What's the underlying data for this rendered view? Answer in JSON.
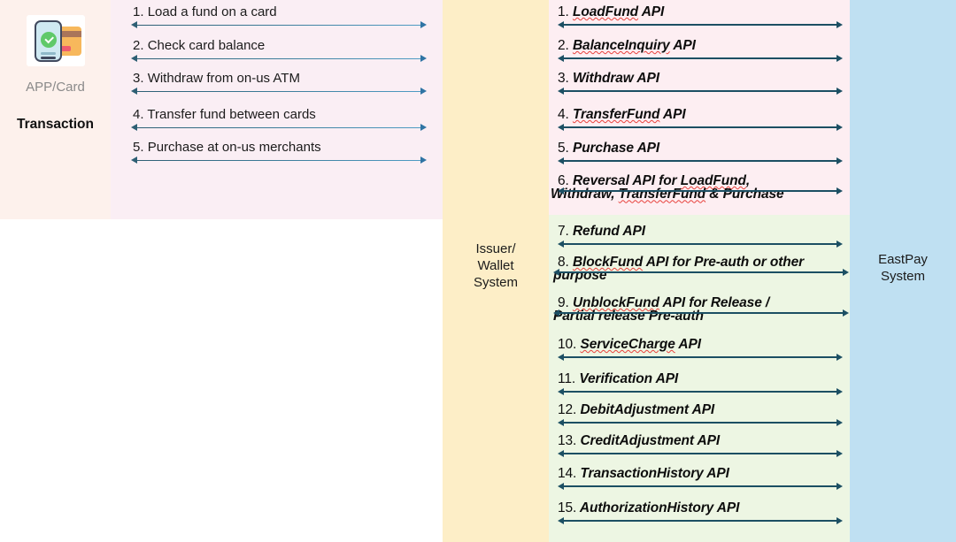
{
  "diagram": {
    "actors": {
      "left": {
        "icon_name": "phone-with-card-icon",
        "label": "APP/Card",
        "sublabel": "Transaction"
      },
      "middle": {
        "label": "Issuer/\nWallet\nSystem",
        "line1": "Issuer/",
        "line2": "Wallet",
        "line3": "System"
      },
      "right": {
        "label": "EastPay\nSystem",
        "line1": "EastPay",
        "line2": "System"
      }
    },
    "transaction_flows": [
      {
        "num": "1.",
        "text": "Load a fund on a card"
      },
      {
        "num": "2.",
        "text": "Check card balance"
      },
      {
        "num": "3.",
        "text": "Withdraw from on-us ATM"
      },
      {
        "num": "4.",
        "text": "Transfer fund between cards"
      },
      {
        "num": "5.",
        "text": "Purchase at on-us merchants"
      }
    ],
    "api_flows_core": [
      {
        "num": "1.",
        "text": "LoadFund API",
        "misspelled": [
          "LoadFund"
        ]
      },
      {
        "num": "2.",
        "text": "BalanceInquiry API",
        "misspelled": [
          "BalanceInquiry"
        ]
      },
      {
        "num": "3.",
        "text": "Withdraw API",
        "misspelled": []
      },
      {
        "num": "4.",
        "text": "TransferFund API",
        "misspelled": [
          "TransferFund"
        ]
      },
      {
        "num": "5.",
        "text": "Purchase API",
        "misspelled": []
      },
      {
        "num": "6.",
        "text": "Reversal API for LoadFund, Withdraw, TransferFund & Purchase",
        "misspelled": [
          "LoadFund",
          "TransferFund"
        ]
      }
    ],
    "api_flows_value": [
      {
        "num": "7.",
        "text": "Refund API",
        "misspelled": []
      },
      {
        "num": "8.",
        "text": "BlockFund API for Pre-auth or other purpose",
        "misspelled": [
          "BlockFund"
        ]
      },
      {
        "num": "9.",
        "text": "UnblockFund API for Release / Partial release Pre-auth",
        "misspelled": [
          "UnblockFund"
        ]
      },
      {
        "num": "10.",
        "text": "ServiceCharge API",
        "misspelled": [
          "ServiceCharge"
        ]
      },
      {
        "num": "11.",
        "text": "Verification API",
        "misspelled": []
      },
      {
        "num": "12.",
        "text": "DebitAdjustment API",
        "misspelled": []
      },
      {
        "num": "13.",
        "text": "CreditAdjustment API",
        "misspelled": []
      },
      {
        "num": "14.",
        "text": "TransactionHistory API",
        "misspelled": []
      },
      {
        "num": "15.",
        "text": "AuthorizationHistory API",
        "misspelled": []
      }
    ],
    "colors": {
      "panel_appcard": "#fdf1ec",
      "panel_transaction": "#faeef4",
      "panel_issuer": "#fdeec7",
      "panel_api_core": "#fdeef2",
      "panel_api_value": "#edf6e3",
      "panel_eastpay": "#bfe0f2",
      "arrow_left": "#2e5f74",
      "arrow_right": "#1c4f63",
      "spellcheck_underline": "#e8413c"
    }
  }
}
